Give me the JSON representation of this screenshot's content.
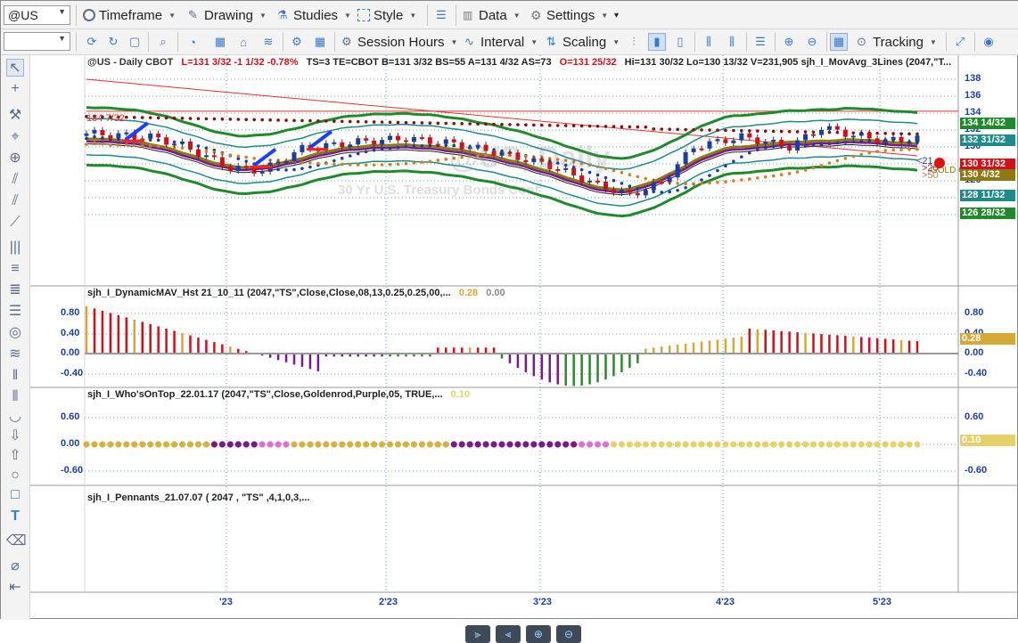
{
  "toolbar1": {
    "symbol": "@US",
    "timeframe": "Timeframe",
    "drawing": "Drawing",
    "studies": "Studies",
    "style": "Style",
    "data": "Data",
    "settings": "Settings"
  },
  "toolbar2": {
    "session_hours": "Session Hours",
    "interval": "Interval",
    "scaling": "Scaling",
    "tracking": "Tracking"
  },
  "price_pane": {
    "header_symbol": "@US - Daily  CBOT",
    "header_stats": "L=131 3/32  -1 1/32  -0.78%",
    "header_rest": "TS=3  TE=CBOT  B=131 3/32  BS=55  A=131 4/32  AS=73",
    "header_ohlc": "O=131 25/32",
    "header_tail": "Hi=131 30/32  Lo=130 13/32  V=231,905  sjh_I_MovAvg_3Lines (2047,\"T...",
    "watermark": "@US, Daily",
    "watermark_sub": "30 Yr U.S. Treasury Bonds Cont",
    "hline_label": "134 7/32",
    "right_text_21": "<21",
    "right_text_20": ">20",
    "right_text_50": ">50",
    "right_text_gold": "GOLD C",
    "y_ticks": [
      "138",
      "136",
      "134",
      "132",
      "130",
      "128",
      "126",
      "124",
      "122"
    ],
    "tags": [
      {
        "text": "134 14/32",
        "color": "#1f8a2b"
      },
      {
        "text": "132 31/32",
        "color": "#1f8a8a"
      },
      {
        "text": "130 31/32",
        "color": "#d0101a"
      },
      {
        "text": "130 4/32",
        "color": "#8a7a10"
      },
      {
        "text": "128 11/32",
        "color": "#1f8a8a"
      },
      {
        "text": "126 28/32",
        "color": "#1f8a2b"
      }
    ]
  },
  "pane2": {
    "title": "sjh_I_DynamicMAV_Hst 21_10_11 (2047,\"TS\",Close,Close,08,13,0.25,0.25,00,...",
    "value1": "0.28",
    "value2": "0.00",
    "y_ticks": [
      "0.80",
      "0.40",
      "0.00",
      "-0.40"
    ],
    "tag": "0.28"
  },
  "pane3": {
    "title": "sjh_I_Who'sOnTop_22.01.17 (2047,\"TS\",Close,Goldenrod,Purple,05, TRUE,...",
    "value1": "0.10",
    "y_ticks": [
      "0.60",
      "0.00",
      "-0.60"
    ],
    "tag": "0.10"
  },
  "pane4": {
    "title": "sjh_I_Pennants_21.07.07 ( 2047 , \"TS\" ,4,1,0,3,..."
  },
  "x_labels": [
    "'23",
    "2'23",
    "3'23",
    "4'23",
    "5'23"
  ],
  "colors": {
    "accent": "#3a78c8",
    "up_candle": "#1a3fa0",
    "down_candle": "#d0101a",
    "green_band": "#1f8a2b",
    "teal_band": "#1f8a8a",
    "hist_red": "#d0101a",
    "hist_gold": "#d6a83a",
    "hist_purple": "#7a1a8a",
    "hist_green": "#2a8a2a"
  }
}
